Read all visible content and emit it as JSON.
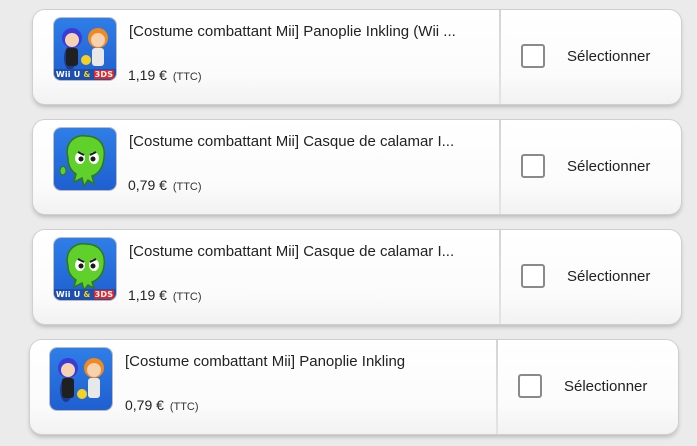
{
  "items": [
    {
      "title": "[Costume combattant Mii] Panoplie Inkling (Wii ...",
      "price": "1,19 €",
      "price_suffix": "(TTC)",
      "icon": "inkling-outfit-icon",
      "platform_badge": {
        "left": "Wii U",
        "amp": "&",
        "right": "3DS"
      },
      "select_label": "Sélectionner",
      "selected": false
    },
    {
      "title": "[Costume combattant Mii] Casque de calamar I...",
      "price": "0,79 €",
      "price_suffix": "(TTC)",
      "icon": "squid-hat-icon",
      "platform_badge": null,
      "select_label": "Sélectionner",
      "selected": false
    },
    {
      "title": "[Costume combattant Mii] Casque de calamar I...",
      "price": "1,19 €",
      "price_suffix": "(TTC)",
      "icon": "squid-hat-icon",
      "platform_badge": {
        "left": "Wii U",
        "amp": "&",
        "right": "3DS"
      },
      "select_label": "Sélectionner",
      "selected": false
    },
    {
      "title": "[Costume combattant Mii] Panoplie Inkling",
      "price": "0,79 €",
      "price_suffix": "(TTC)",
      "icon": "inkling-outfit-icon",
      "platform_badge": null,
      "select_label": "Sélectionner",
      "selected": false
    }
  ],
  "colors": {
    "background": "#ebebeb",
    "icon_blue": "#2f7ee8",
    "squid_green": "#5fd12a",
    "inkling_orange": "#f08a1e",
    "badge_red": "#e0262b"
  }
}
